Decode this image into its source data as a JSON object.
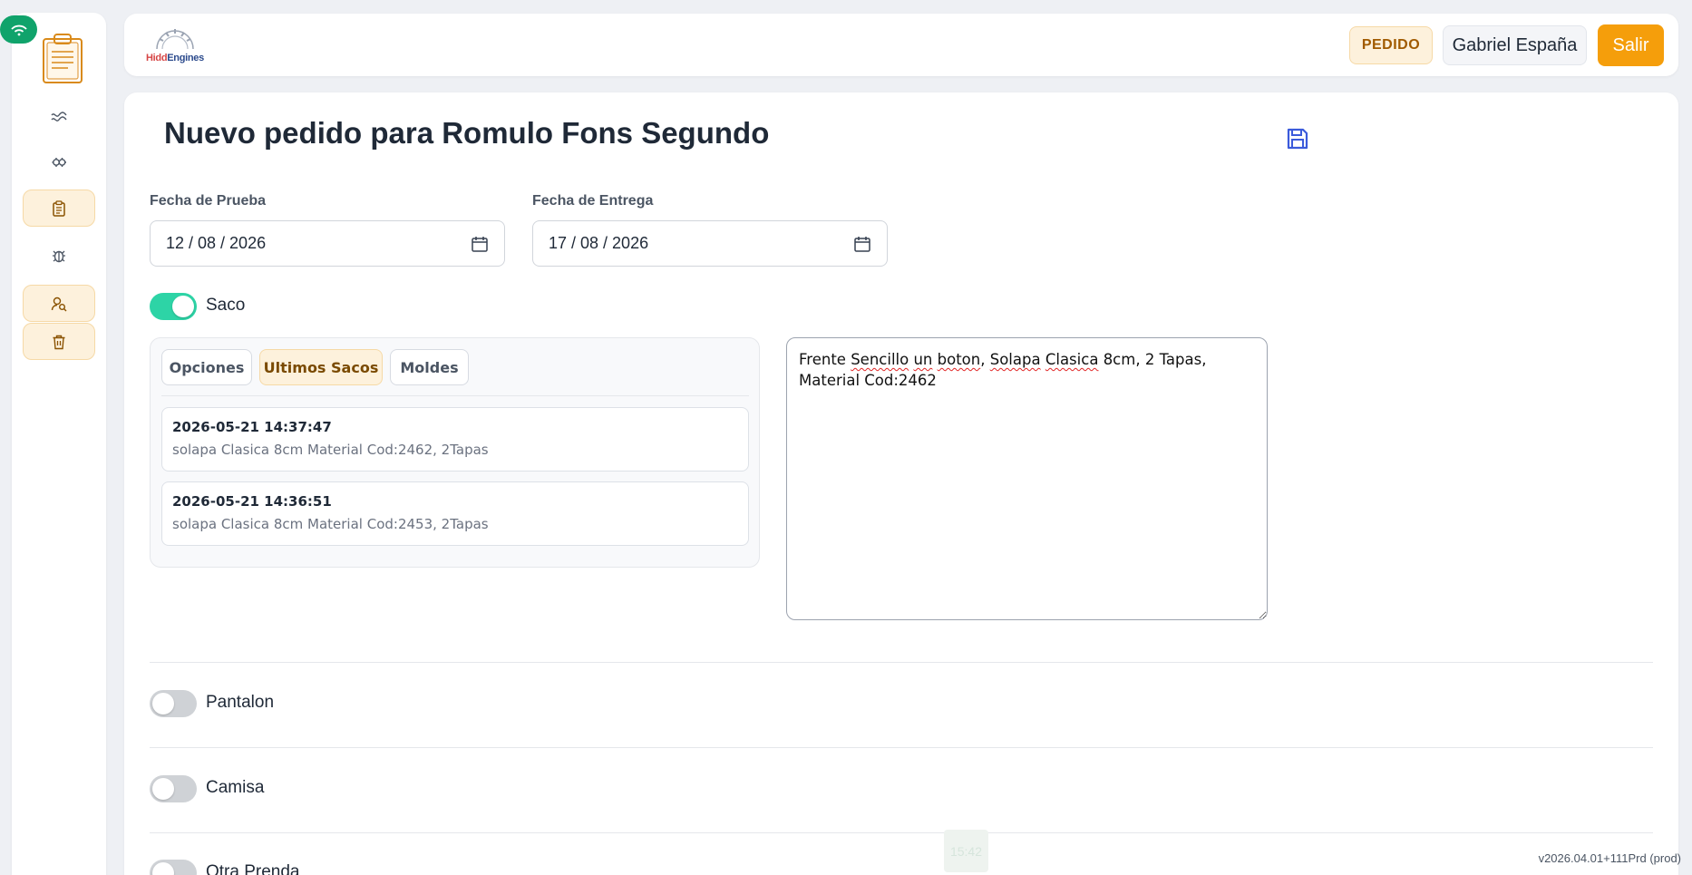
{
  "header": {
    "brand_hidd": "Hidd",
    "brand_engines": "Engines",
    "mode_badge": "PEDIDO",
    "user_name": "Gabriel España",
    "logout_label": "Salir"
  },
  "sidebar": {
    "items": [
      {
        "icon": "chart-wave-icon",
        "active": false
      },
      {
        "icon": "cogs-icon",
        "active": false
      },
      {
        "icon": "clipboard-icon",
        "active": true
      },
      {
        "icon": "bug-icon",
        "active": false
      },
      {
        "icon": "user-search-icon",
        "active": true
      },
      {
        "icon": "trash-icon",
        "active": true
      }
    ]
  },
  "main": {
    "title": "Nuevo pedido para Romulo Fons Segundo",
    "fecha_prueba_label": "Fecha de Prueba",
    "fecha_prueba_value": "12 / 08 / 2026",
    "fecha_entrega_label": "Fecha de Entrega",
    "fecha_entrega_value": "17 / 08 / 2026",
    "saco": {
      "label": "Saco",
      "enabled": true,
      "tabs": [
        "Opciones",
        "Ultimos Sacos",
        "Moldes"
      ],
      "active_tab": "Ultimos Sacos",
      "history": [
        {
          "date": "2026-05-21 14:37:47",
          "desc": "solapa Clasica 8cm Material Cod:2462, 2Tapas"
        },
        {
          "date": "2026-05-21 14:36:51",
          "desc": "solapa Clasica 8cm Material Cod:2453, 2Tapas"
        }
      ],
      "notes": {
        "w1": "Frente",
        "w2": "Sencillo",
        "w3": "un",
        "w4": "boton",
        "w5": "Solapa",
        "w6": "Clasica",
        "rest1": "8cm, 2 Tapas,",
        "line2": "Material Cod:2462"
      }
    },
    "pantalon": {
      "label": "Pantalon",
      "enabled": false
    },
    "camisa": {
      "label": "Camisa",
      "enabled": false
    },
    "otra": {
      "label": "Otra Prenda",
      "enabled": false
    }
  },
  "footer": {
    "clock": "15:42",
    "version": "v2026.04.01+111Prd (prod)"
  },
  "colors": {
    "accent_orange": "#f59e0b",
    "toggle_on": "#2dd4a6",
    "active_tab_bg": "#fdf1dc",
    "wifi_green": "#10a36b"
  }
}
